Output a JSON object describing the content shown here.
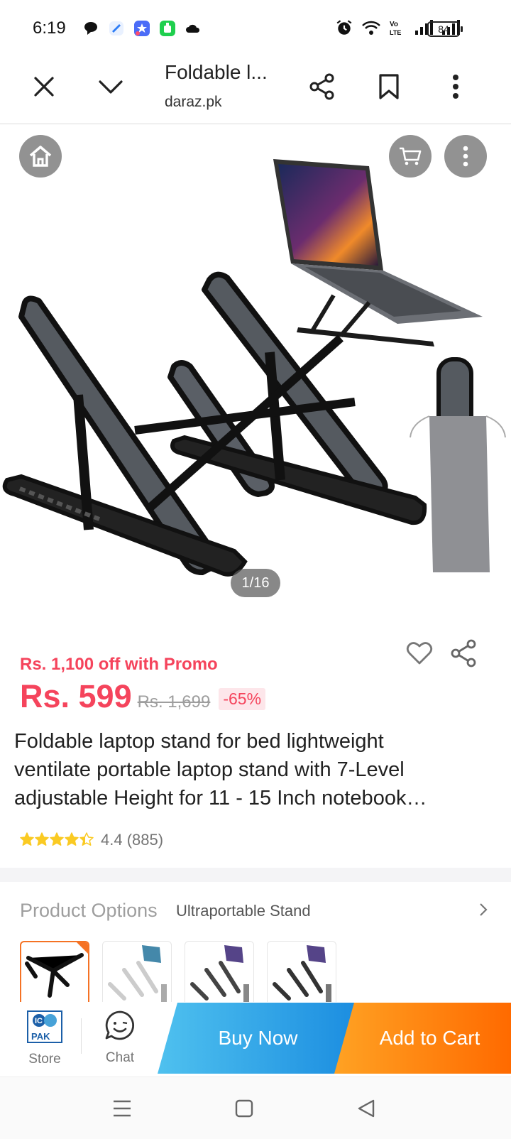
{
  "status_bar": {
    "time": "6:19",
    "battery": "84",
    "icons": [
      "chat-bubble-icon",
      "app-blue-icon",
      "app-star-icon",
      "app-green-icon",
      "cloud-icon",
      "alarm-icon",
      "wifi-icon",
      "volte-icon",
      "signal-icon",
      "signal-icon"
    ]
  },
  "browser": {
    "title": "Foldable l...",
    "url": "daraz.pk",
    "icons": [
      "close-icon",
      "chevron-down-icon",
      "share-icon",
      "bookmark-icon",
      "more-vert-icon"
    ]
  },
  "gallery": {
    "counter": "1/16",
    "icons": [
      "home-icon",
      "cart-icon",
      "more-vert-icon"
    ]
  },
  "product": {
    "promo": "Rs. 1,100 off with Promo",
    "price": "Rs. 599",
    "original_price": "Rs. 1,699",
    "discount": "-65%",
    "title_lines": [
      "Foldable laptop stand for bed lightweight",
      "ventilate portable laptop stand with 7-Level",
      "adjustable Height for 11 - 15 Inch notebook…"
    ],
    "rating_stars": 4.4,
    "rating_text": "4.4 (885)"
  },
  "options": {
    "label": "Product Options",
    "value": "Ultraportable Stand"
  },
  "action_bar": {
    "store_logo_top": "IC",
    "store_logo_bottom": "PAK",
    "store_label": "Store",
    "chat_label": "Chat",
    "buy_now": "Buy Now",
    "add_to_cart": "Add to Cart"
  },
  "colors": {
    "accent_red": "#f5445c",
    "buy_now": "#1b8de0",
    "add_to_cart": "#ff6a00",
    "star": "#faca23"
  }
}
